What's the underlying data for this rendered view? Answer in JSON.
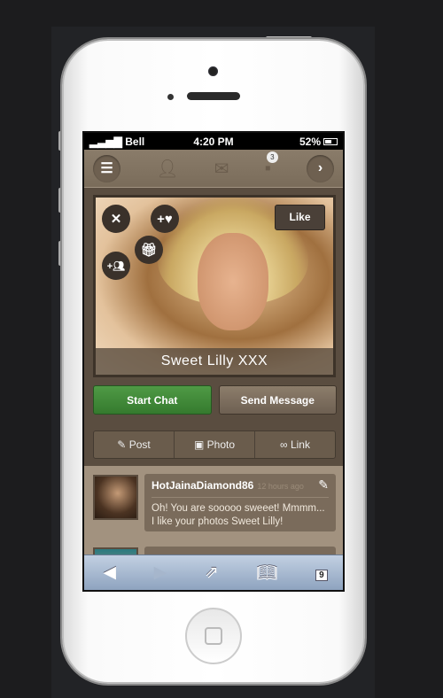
{
  "status": {
    "carrier": "Bell",
    "time": "4:20 PM",
    "battery": "52%"
  },
  "nav": {
    "badge_count": "3"
  },
  "profile": {
    "name": "Sweet Lilly XXX",
    "like_label": "Like"
  },
  "actions": {
    "start_chat": "Start Chat",
    "send_message": "Send Message"
  },
  "tabs": [
    {
      "label": "Post",
      "icon": "pin"
    },
    {
      "label": "Photo",
      "icon": "image"
    },
    {
      "label": "Link",
      "icon": "link"
    }
  ],
  "feed": [
    {
      "username": "HotJainaDiamond86",
      "time": "12 hours ago",
      "text": "Oh! You are sooooo sweeet! Mmmm... I like your photos Sweet Lilly!"
    }
  ],
  "browser": {
    "tab_count": "9"
  },
  "colors": {
    "start_chat": "#3f8a38",
    "toolbar": "#a8b9d0",
    "app_bg": "#5a4d40"
  }
}
